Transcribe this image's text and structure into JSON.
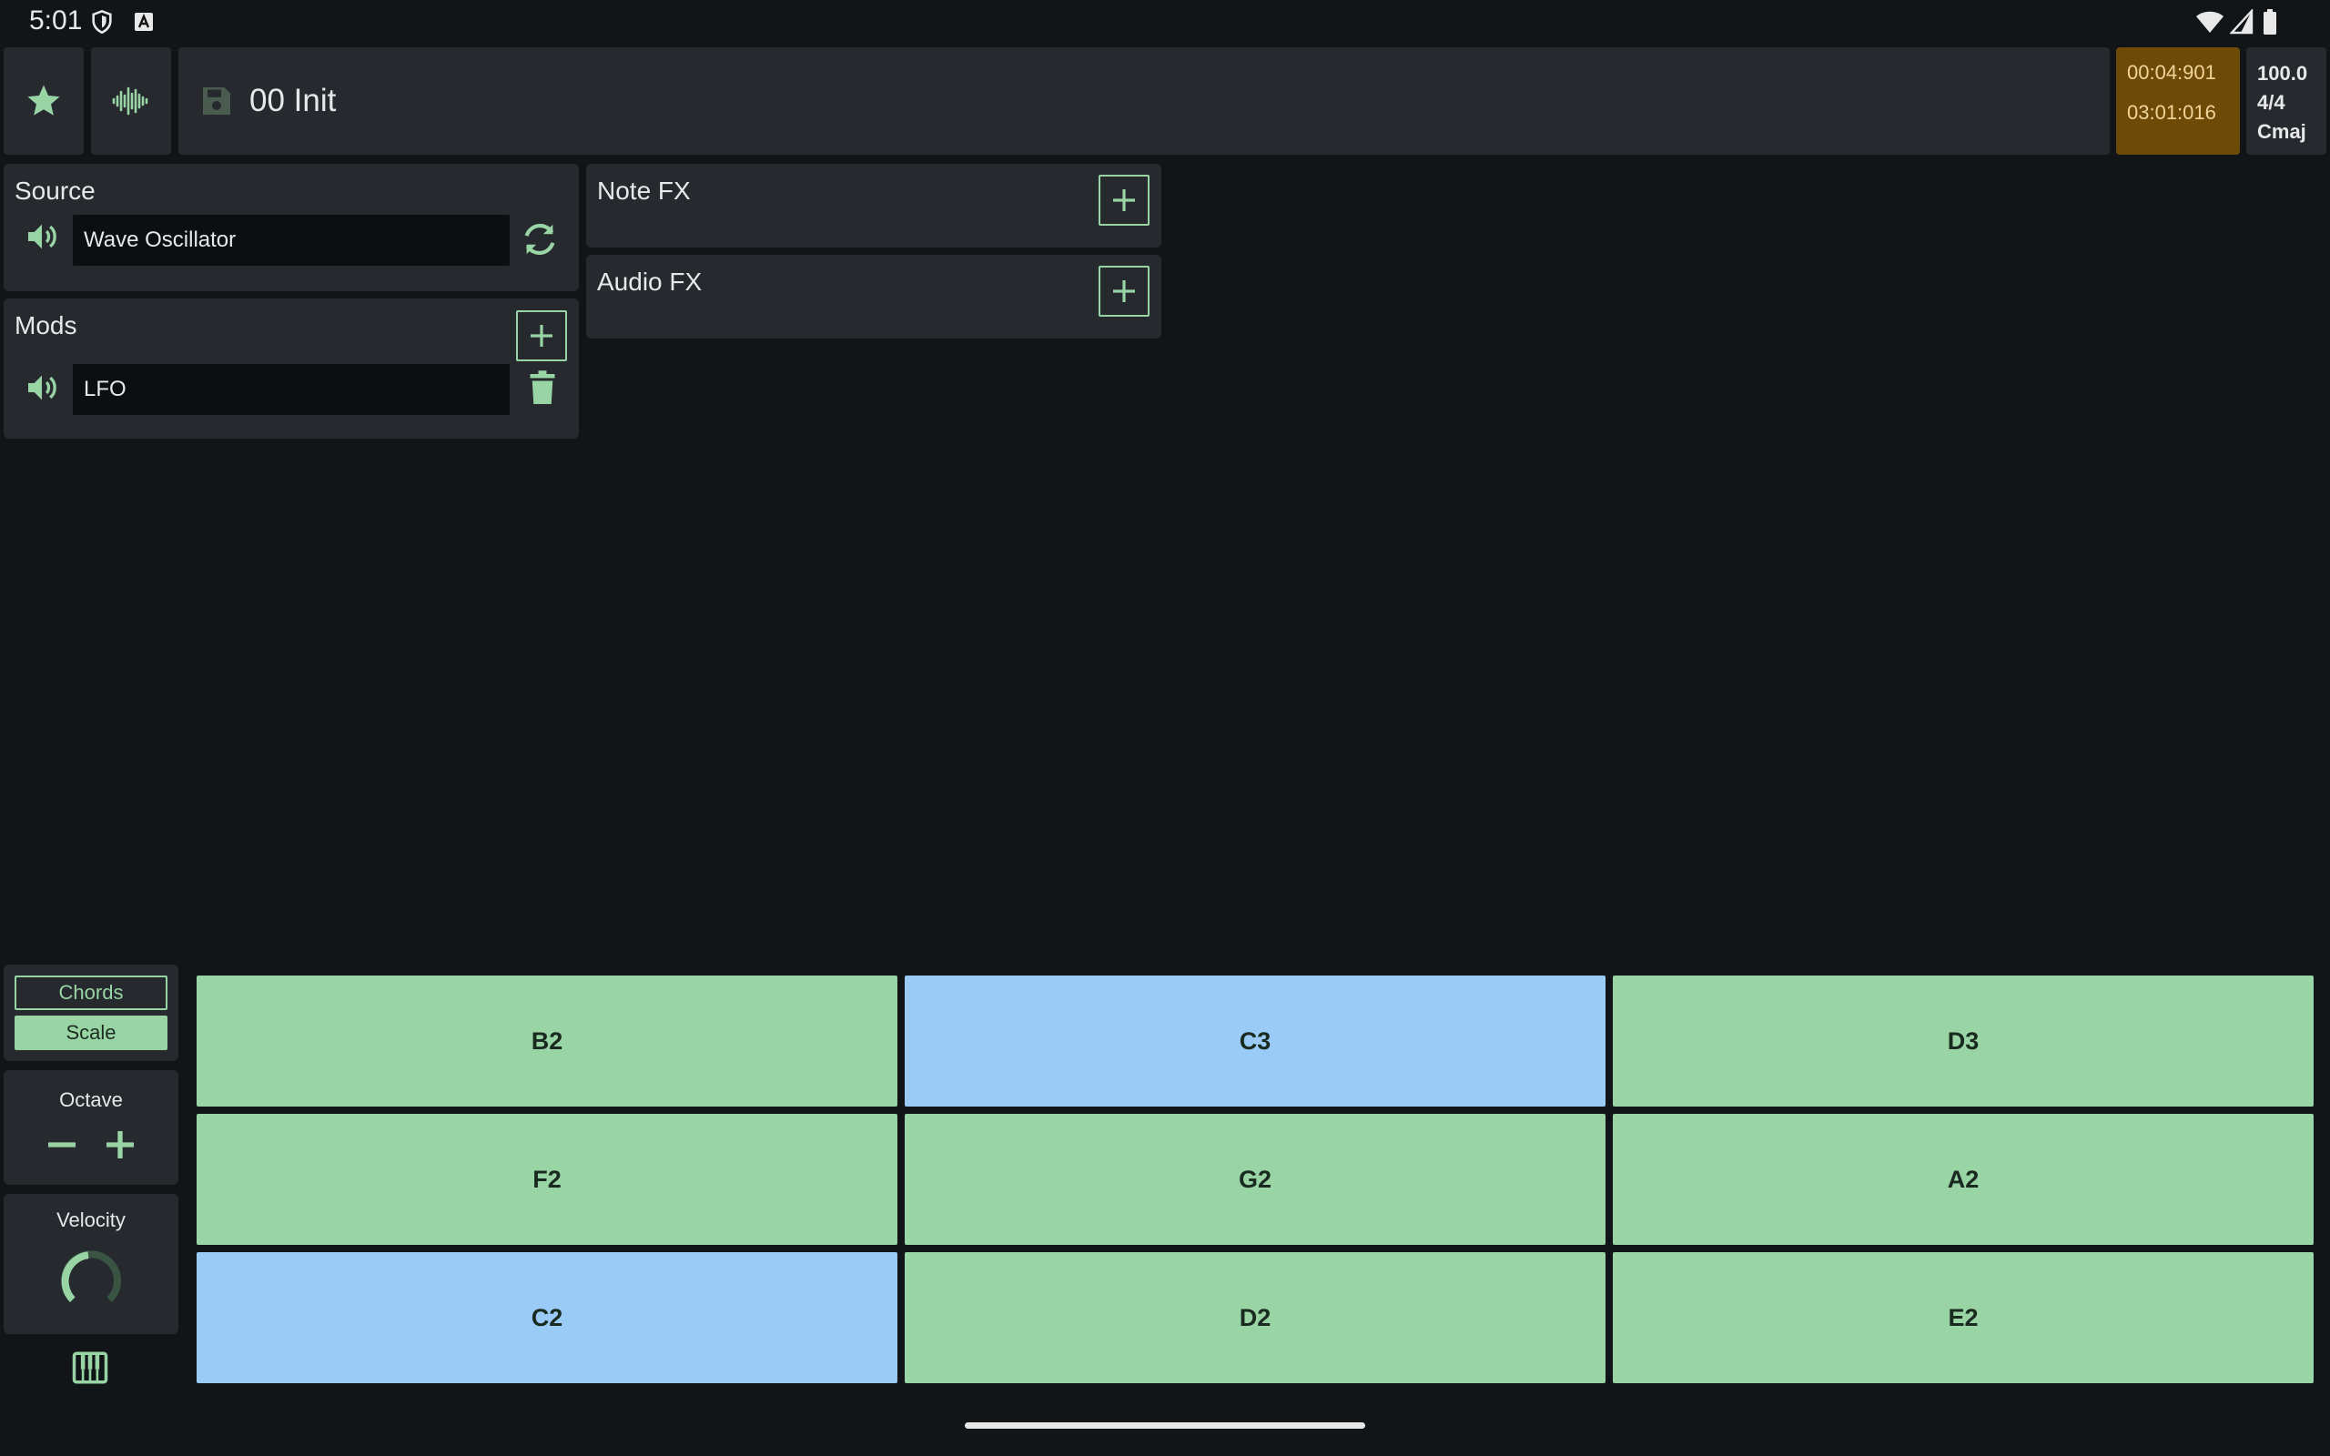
{
  "status_bar": {
    "time": "5:01",
    "icons": [
      "shield-icon",
      "a-badge-icon",
      "wifi-icon",
      "cellular-signal-icon",
      "battery-icon"
    ]
  },
  "toolbar": {
    "favorite_icon": "star-icon",
    "waveform_icon": "waveform-icon",
    "save_icon": "floppy-disk-icon",
    "preset_name": "00 Init",
    "time_primary": "00:04:901",
    "time_secondary": "03:01:016",
    "tempo": "100.0",
    "time_signature": "4/4",
    "key": "Cmaj"
  },
  "source_panel": {
    "title": "Source",
    "value": "Wave Oscillator",
    "speaker_icon": "speaker-icon",
    "swap_icon": "refresh-icon"
  },
  "mods_panel": {
    "title": "Mods",
    "add_icon": "plus-icon",
    "item": "LFO",
    "delete_icon": "trash-icon"
  },
  "note_fx_panel": {
    "title": "Note FX",
    "add_icon": "plus-icon"
  },
  "audio_fx_panel": {
    "title": "Audio FX",
    "add_icon": "plus-icon"
  },
  "keyboard_controls": {
    "chords_label": "Chords",
    "scale_label": "Scale",
    "octave_label": "Octave",
    "velocity_label": "Velocity",
    "piano_icon": "piano-keys-icon"
  },
  "pads": [
    [
      "B2",
      "C3",
      "D3"
    ],
    [
      "F2",
      "G2",
      "A2"
    ],
    [
      "C2",
      "D2",
      "E2"
    ]
  ],
  "colors": {
    "accent": "#98d4a4",
    "root_note": "#99cbf6",
    "background": "#111518",
    "panel": "#262a2f",
    "timer_bg": "#6e4a07"
  }
}
